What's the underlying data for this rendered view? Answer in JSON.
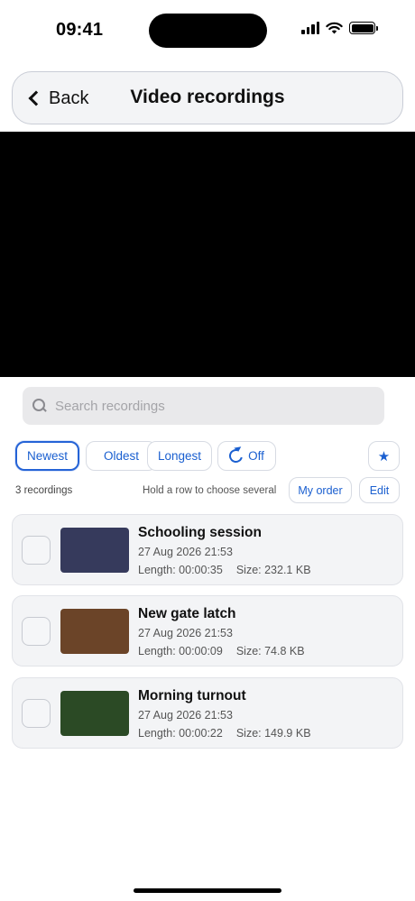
{
  "status_bar": {
    "time": "09:41"
  },
  "nav": {
    "back_label": "Back",
    "title": "Video recordings"
  },
  "search": {
    "placeholder": "Search recordings",
    "value": ""
  },
  "sort": {
    "options": [
      "Newest",
      "Oldest",
      "Longest"
    ],
    "selected": "Newest",
    "loop_label": "Off",
    "favorite_icon": "star-icon"
  },
  "info": {
    "count": "3 recordings",
    "hint": "Hold a row to choose several",
    "my_order_label": "My order",
    "edit_label": "Edit"
  },
  "recordings": [
    {
      "title": "Schooling session",
      "date": "27 Aug 2026 21:53",
      "length": "Length: 00:00:35",
      "size": "Size: 232.1 KB",
      "thumb_color": "#363a5c"
    },
    {
      "title": "New gate latch",
      "date": "27 Aug 2026 21:53",
      "length": "Length: 00:00:09",
      "size": "Size: 74.8 KB",
      "thumb_color": "#6b4428"
    },
    {
      "title": "Morning turnout",
      "date": "27 Aug 2026 21:53",
      "length": "Length: 00:00:22",
      "size": "Size: 149.9 KB",
      "thumb_color": "#2b4a25"
    }
  ],
  "colors": {
    "accent": "#2563d6",
    "card_bg": "#f3f4f6",
    "video_bg": "#000000"
  }
}
